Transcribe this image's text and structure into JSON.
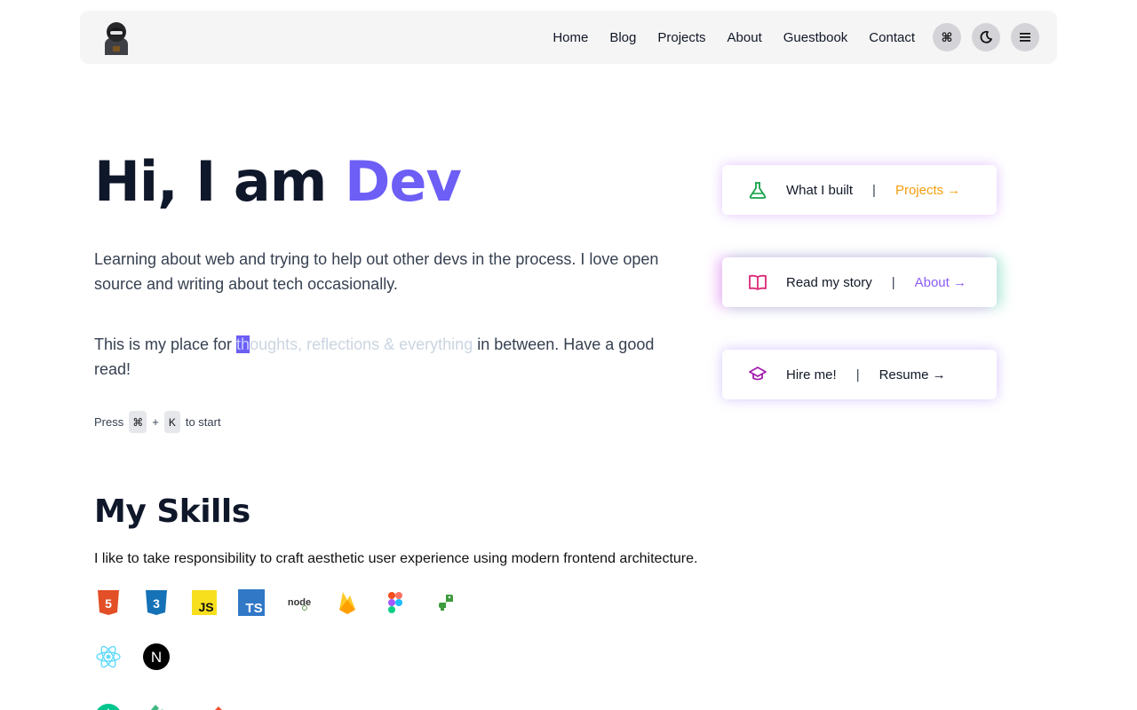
{
  "nav": {
    "links": [
      "Home",
      "Blog",
      "Projects",
      "About",
      "Guestbook",
      "Contact"
    ],
    "cmd_label": "⌘"
  },
  "hero": {
    "greeting": "Hi, I am ",
    "name": "Dev",
    "intro": "Learning about web and trying to help out other devs in the process. I love open source and writing about tech occasionally.",
    "tagline_prefix": "This is my place for ",
    "tagline_highlight": "th",
    "tagline_faded": "oughts, reflections & everything",
    "tagline_suffix": " in between. Have a good read!",
    "press_label": "Press",
    "press_key1": "⌘",
    "press_plus": "+",
    "press_key2": "K",
    "press_suffix": "to start"
  },
  "cards": [
    {
      "icon": "flask-icon",
      "label": "What I built",
      "link": "Projects →"
    },
    {
      "icon": "book-icon",
      "label": "Read my story",
      "link": "About →"
    },
    {
      "icon": "graduation-cap-icon",
      "label": "Hire me!",
      "link": "Resume →"
    }
  ],
  "skills": {
    "title": "My Skills",
    "description": "I like to take responsibility to craft aesthetic user experience using modern frontend architecture.",
    "icons": [
      "html5-icon",
      "css3-icon",
      "javascript-icon",
      "typescript-icon",
      "nodejs-icon",
      "firebase-icon",
      "figma-icon",
      "python-icon",
      "react-icon",
      "nextjs-icon",
      "nuxt-icon",
      "vue-icon",
      "git-icon"
    ],
    "html5_label": "5",
    "css3_label": "3",
    "js_label": "JS",
    "ts_label": "TS",
    "node_label": "node",
    "next_label": "N"
  },
  "colors": {
    "accent": "#6d5ef5",
    "projects_link": "#f59e0b",
    "about_link": "#8b5cf6"
  }
}
